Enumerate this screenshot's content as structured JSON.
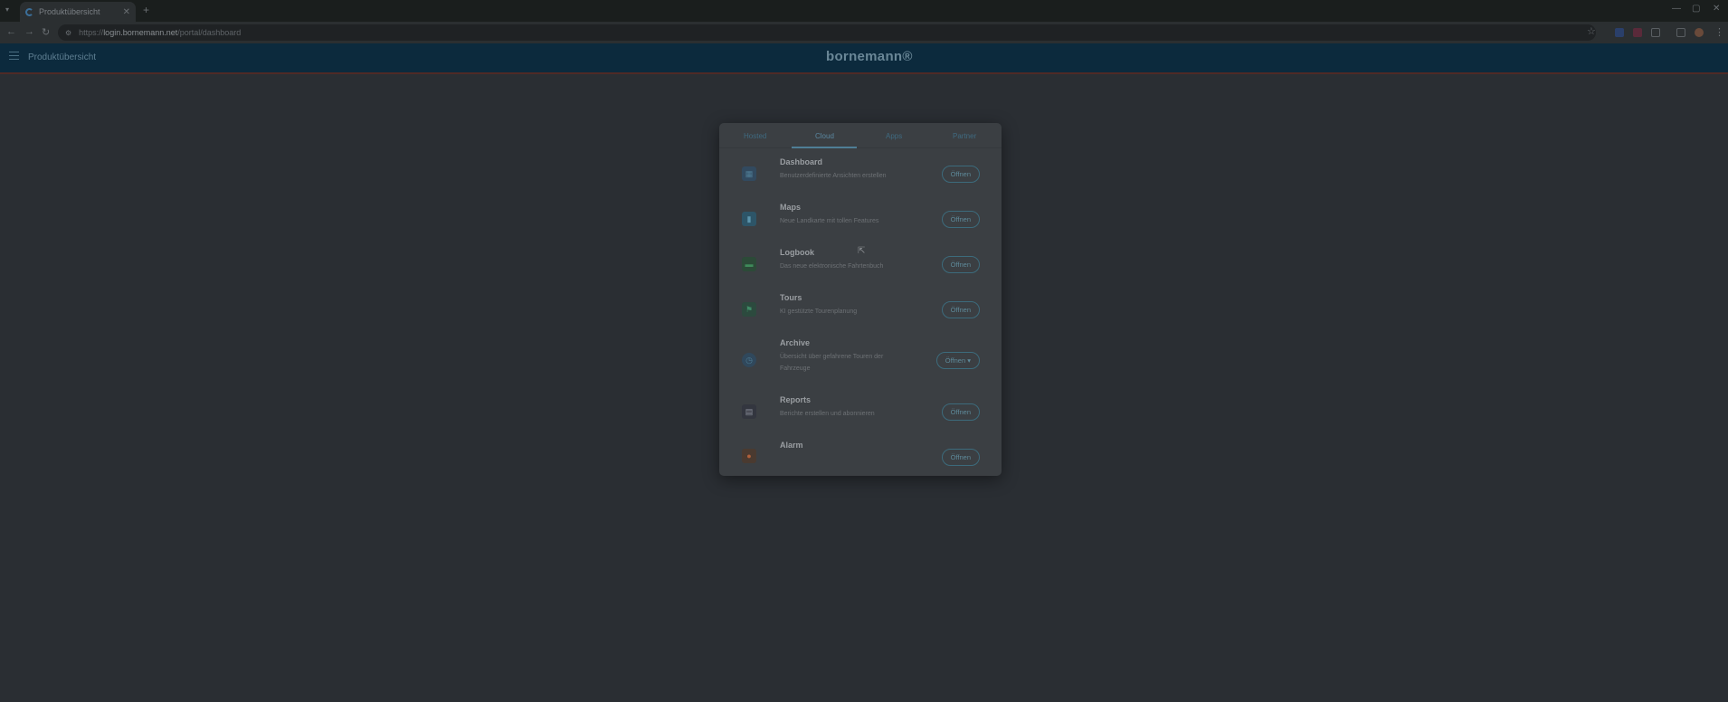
{
  "browser": {
    "tab_title": "Produktübersicht",
    "tab_close": "✕",
    "new_tab": "+",
    "url_prefix": "https://",
    "url_host": "login.bornemann.net",
    "url_path": "/portal/dashboard",
    "controls": {
      "minimize": "—",
      "maximize": "▢",
      "close": "✕"
    }
  },
  "app": {
    "title": "Produktübersicht",
    "logo": "bornemann®"
  },
  "dialog": {
    "tabs": [
      "Hosted",
      "Cloud",
      "Apps",
      "Partner"
    ],
    "active_tab": "Cloud",
    "items": [
      {
        "name": "Dashboard",
        "description": "Benutzerdefinierte Ansichten erstellen",
        "button": "Öffnen",
        "icon": "dashboard-icon",
        "icon_color": "#3a5a77"
      },
      {
        "name": "Maps",
        "description": "Neue Landkarte mit tollen Features",
        "button": "Öffnen",
        "icon": "map-icon",
        "icon_color": "#2f6d8a"
      },
      {
        "name": "Logbook",
        "description": "Das neue elektronische Fahrtenbuch",
        "button": "Öffnen",
        "icon": "car-icon",
        "icon_color": "#2f6b3e"
      },
      {
        "name": "Tours",
        "description": "KI gestützte Tourenplanung",
        "button": "Öffnen",
        "icon": "flag-icon",
        "icon_color": "#2f6b4e"
      },
      {
        "name": "Archive",
        "description": "Übersicht über gefahrene Touren der Fahrzeuge",
        "button": "Öffnen ▾",
        "icon": "clock-icon",
        "icon_color": "#3a5a77"
      },
      {
        "name": "Reports",
        "description": "Berichte erstellen und abonnieren",
        "button": "Öffnen",
        "icon": "report-icon",
        "icon_color": "#3a3e4a"
      },
      {
        "name": "Alarm",
        "description": "",
        "button": "Öffnen",
        "icon": "alarm-icon",
        "icon_color": "#7a4a2a"
      }
    ]
  }
}
